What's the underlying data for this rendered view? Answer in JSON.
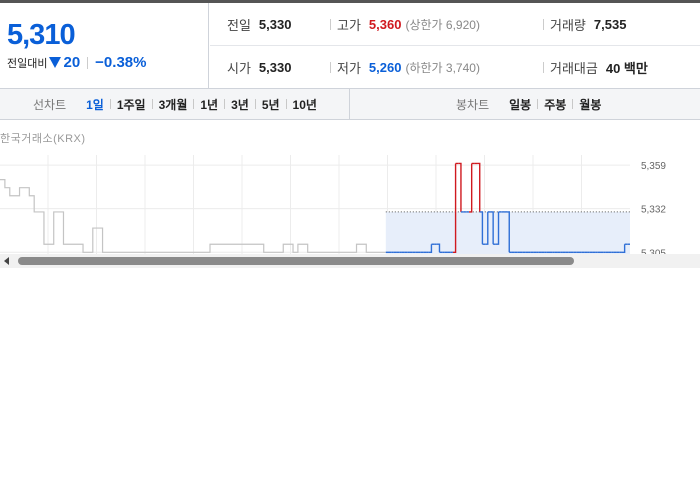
{
  "quote": {
    "current_price": "5,310",
    "change_label": "전일대비",
    "change_icon": "down-triangle-icon",
    "change_amount": "20",
    "change_rate": "−0.38%"
  },
  "stats": {
    "prev_close": {
      "label": "전일",
      "value": "5,330"
    },
    "high": {
      "label": "고가",
      "value": "5,360",
      "sub": "(상한가 6,920)"
    },
    "volume": {
      "label": "거래량",
      "value": "7,535"
    },
    "open": {
      "label": "시가",
      "value": "5,330"
    },
    "low": {
      "label": "저가",
      "value": "5,260",
      "sub": "(하한가 3,740)"
    },
    "trade_value": {
      "label": "거래대금",
      "value": "40 백만"
    }
  },
  "toolbar": {
    "line_chart_label": "선차트",
    "line_periods": [
      "1일",
      "1주일",
      "3개월",
      "1년",
      "3년",
      "5년",
      "10년"
    ],
    "active_period": "1일",
    "candle_chart_label": "봉차트",
    "candle_periods": [
      "일봉",
      "주봉",
      "월봉"
    ]
  },
  "chart_data": {
    "type": "line",
    "source_label": "한국거래소(KRX)",
    "y_ticks": [
      "5,359",
      "5,332",
      "5,305"
    ],
    "ylim": [
      5298,
      5364
    ],
    "x_count": 130,
    "reference_price": 5330,
    "grid": true,
    "colors": {
      "past": "#c4c4c4",
      "below": "#2f6fd6",
      "above": "#d0191f",
      "fill": "#e7eefa",
      "grid": "#ececec"
    },
    "past_series": [
      5350,
      5345,
      5340,
      5340,
      5345,
      5345,
      5340,
      5330,
      5330,
      5310,
      5310,
      5330,
      5330,
      5310,
      5310,
      5310,
      5310,
      5305,
      5305,
      5320,
      5320,
      5305,
      5305,
      5305,
      5305,
      5305,
      5305,
      5305,
      5305,
      5305,
      5305,
      5305,
      5305,
      5305,
      5305,
      5305,
      5305,
      5305,
      5305,
      5305,
      5305,
      5305,
      5305,
      5310,
      5310,
      5310,
      5310,
      5310,
      5310,
      5310,
      5310,
      5310,
      5310,
      5310,
      5305,
      5305,
      5305,
      5305,
      5310,
      5310,
      5305,
      5310,
      5310,
      5305,
      5305,
      5305,
      5305,
      5305,
      5305,
      5305,
      5305,
      5305,
      5305,
      5310,
      5310,
      5305,
      5305,
      5305,
      5305,
      5305,
      5305,
      5305,
      5305,
      5310,
      5310,
      5305,
      5305,
      5305,
      5305,
      5305,
      5305,
      5305,
      5305,
      5305,
      5305,
      5305,
      5305,
      5305,
      5305,
      5305,
      5305,
      5305,
      5305,
      5305,
      5305,
      5305,
      5305,
      5305,
      5305,
      5305,
      5305,
      5305,
      5305,
      5305,
      5310,
      5310,
      5310,
      5305,
      5305,
      5305,
      5305,
      5305,
      5305,
      5305,
      5305,
      5305,
      5305,
      5305,
      5305,
      5305
    ],
    "today_series": [
      5305,
      5305,
      5305,
      5305,
      5305,
      5305,
      5305,
      5305,
      5305,
      5305,
      5305,
      5305,
      5305,
      5305,
      5305,
      5305,
      5305,
      5310,
      5310,
      5310,
      5305,
      5305,
      5305,
      5305,
      5305,
      5305,
      5360,
      5360,
      5330,
      5330,
      5330,
      5330,
      5360,
      5360,
      5360,
      5330,
      5310,
      5310,
      5330,
      5330,
      5310,
      5310,
      5330,
      5330,
      5330,
      5330,
      5305,
      5305,
      5305,
      5305,
      5305,
      5305,
      5305,
      5305,
      5305,
      5305,
      5305,
      5305,
      5305,
      5305,
      5305,
      5305,
      5305,
      5305,
      5305,
      5305,
      5305,
      5305,
      5305,
      5305,
      5305,
      5305,
      5305,
      5305,
      5305,
      5305,
      5305,
      5305,
      5305,
      5305,
      5305,
      5305,
      5305,
      5305,
      5305,
      5305,
      5305,
      5305,
      5305,
      5310,
      5310,
      5310
    ],
    "today_start_index": 79
  },
  "scrollbar": {
    "arrow_icon": "scroll-left-arrow-icon"
  }
}
